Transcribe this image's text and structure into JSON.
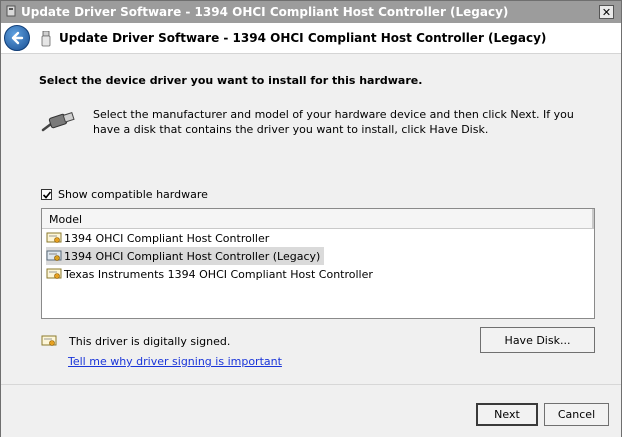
{
  "window": {
    "title": "Update Driver Software - 1394 OHCI Compliant Host Controller (Legacy)",
    "close_label": "✕"
  },
  "header": {
    "title": "Update Driver Software - 1394 OHCI Compliant Host Controller (Legacy)",
    "back_icon": "back-arrow-icon",
    "device_icon": "usb-device-icon"
  },
  "main": {
    "instruction": "Select the device driver you want to install for this hardware.",
    "description": "Select the manufacturer and model of your hardware device and then click Next. If you have a disk that contains the driver you want to install, click Have Disk.",
    "show_compatible_label": "Show compatible hardware",
    "show_compatible_checked": true,
    "list": {
      "column_header": "Model",
      "items": [
        {
          "label": "1394 OHCI Compliant Host Controller",
          "selected": false
        },
        {
          "label": "1394 OHCI Compliant Host Controller (Legacy)",
          "selected": true
        },
        {
          "label": "Texas Instruments 1394 OHCI Compliant Host Controller",
          "selected": false
        }
      ]
    },
    "signed_text": "This driver is digitally signed.",
    "signing_link": "Tell me why driver signing is important",
    "have_disk_label": "Have Disk..."
  },
  "footer": {
    "next_label": "Next",
    "cancel_label": "Cancel"
  }
}
